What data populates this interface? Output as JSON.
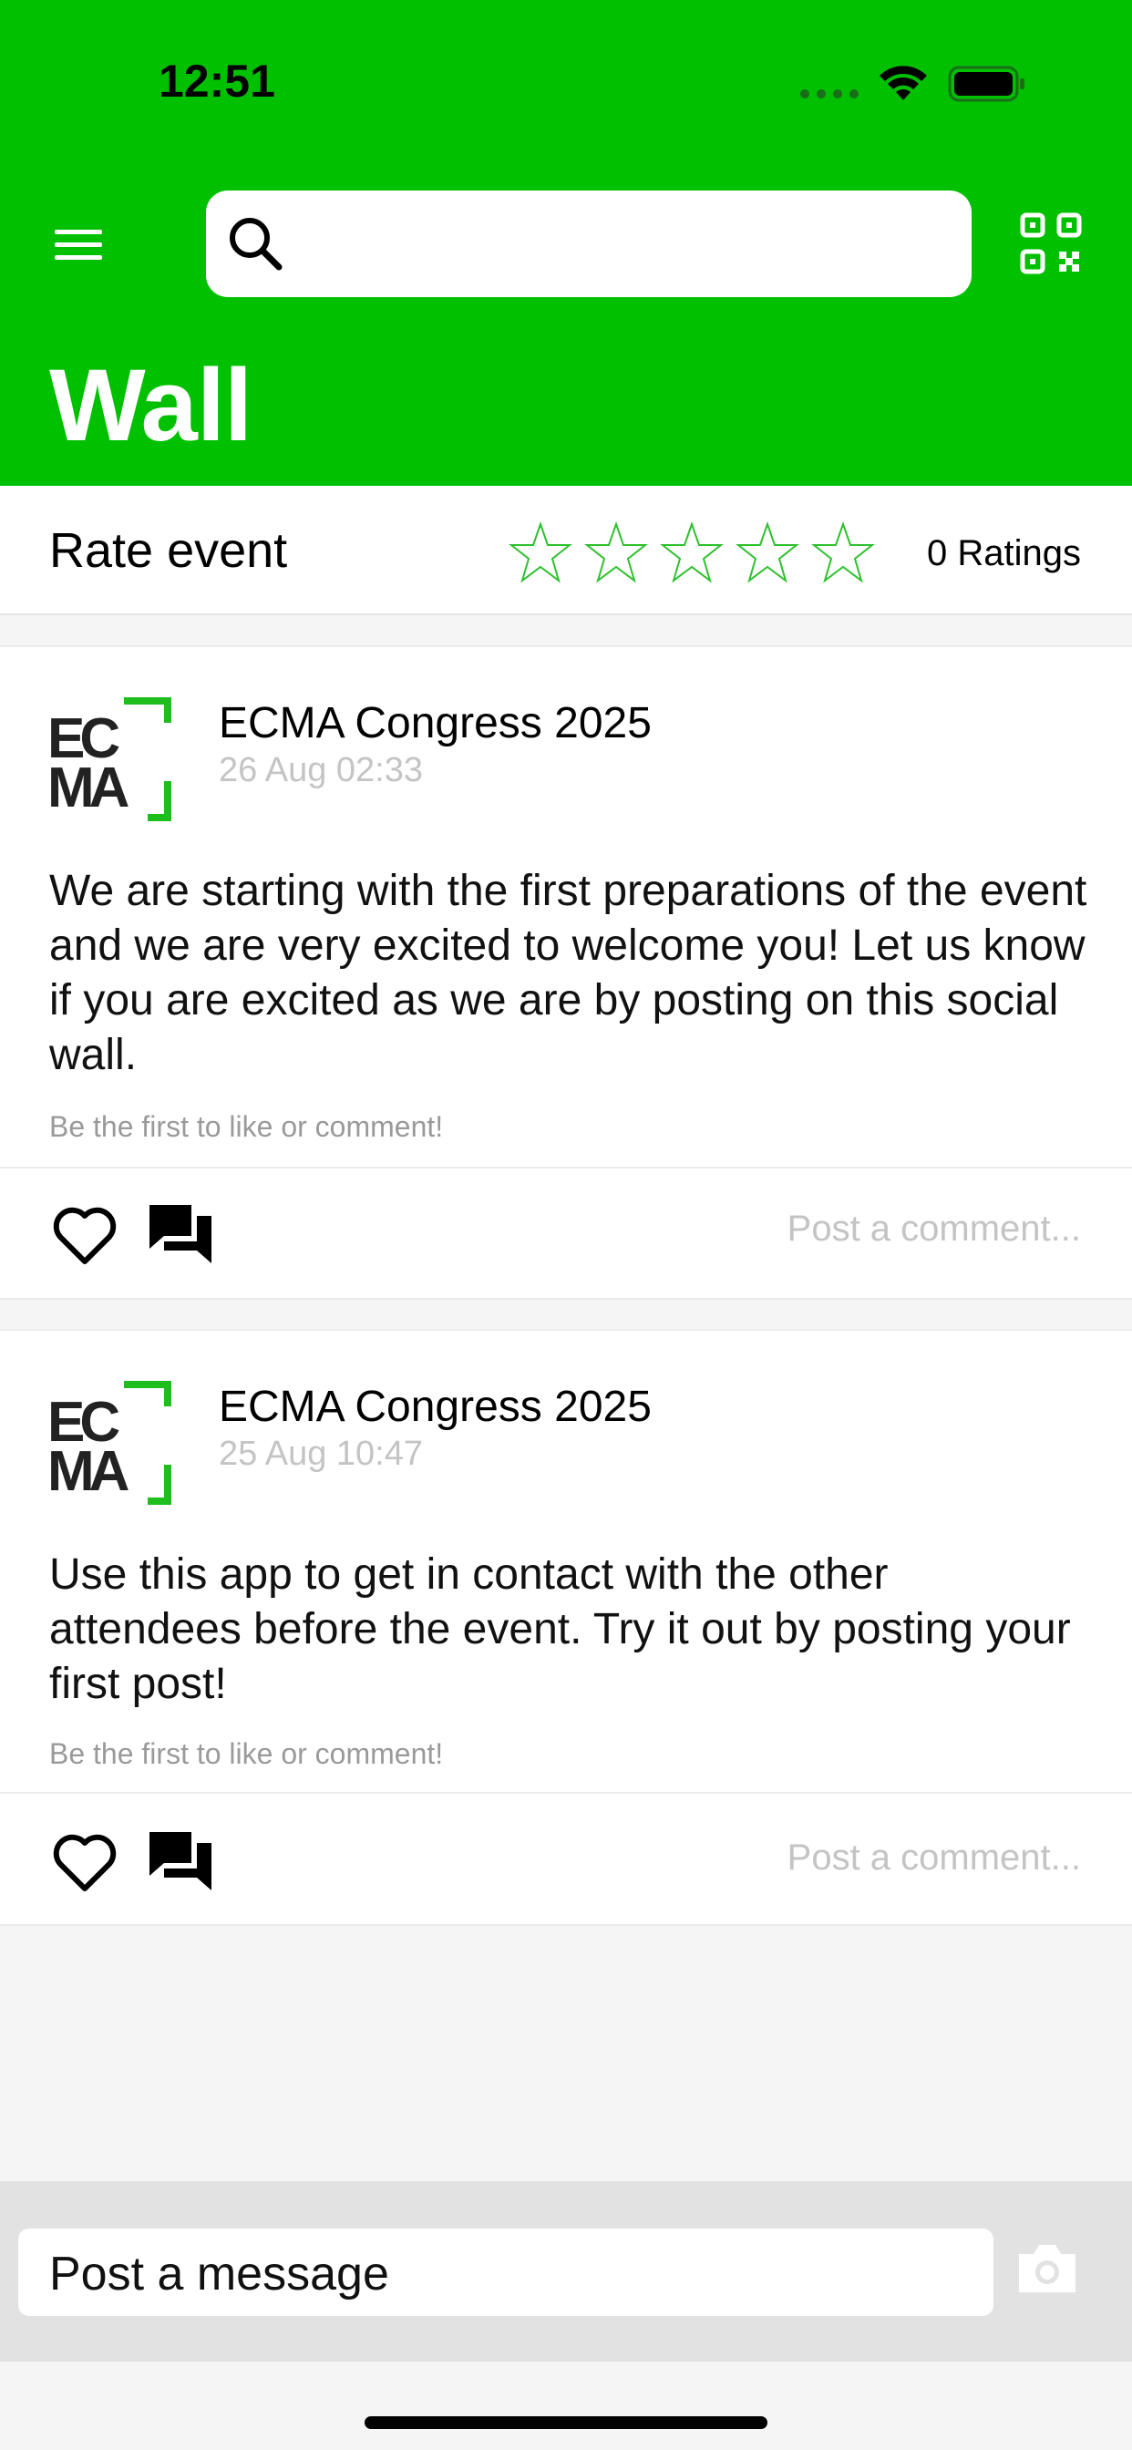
{
  "status_bar": {
    "time": "12:51"
  },
  "header": {
    "title": "Wall",
    "search": {
      "value": ""
    },
    "colors": {
      "brand": "#00c000"
    },
    "icons": {
      "menu": "menu-icon",
      "search": "search-icon",
      "qr": "qr-code-icon"
    }
  },
  "rating": {
    "label": "Rate event",
    "stars_filled": 0,
    "stars_total": 5,
    "count_text": "0 Ratings"
  },
  "posts": [
    {
      "author": "ECMA Congress 2025",
      "date": "26 Aug 02:33",
      "body": "We are starting with the first preparations of the event and we are very excited to welcome you! Let us know if you are excited as we are by posting on this social wall.",
      "hint": "Be the first to like or comment!",
      "comment_link": "Post a comment..."
    },
    {
      "author": "ECMA Congress 2025",
      "date": "25 Aug 10:47",
      "body": "Use this app to get in contact with the other attendees before the event. Try it out by posting your first post!",
      "hint": "Be the first to like or comment!",
      "comment_link": "Post a comment..."
    }
  ],
  "logo": {
    "letters": "ECMA"
  },
  "composer": {
    "placeholder": "Post a message",
    "icon": "camera-icon"
  }
}
